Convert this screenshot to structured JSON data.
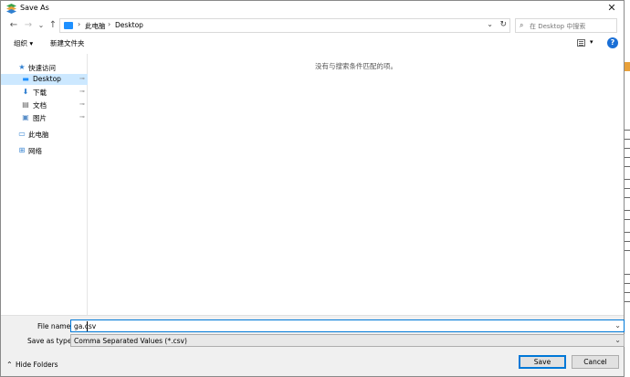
{
  "window": {
    "title": "Save As",
    "close_glyph": "✕"
  },
  "nav": {
    "back": "←",
    "forward": "→",
    "recent": "⌄",
    "up": "↑",
    "breadcrumb": [
      "此电脑",
      "Desktop"
    ],
    "search_placeholder": "在 Desktop 中搜索"
  },
  "toolbar": {
    "organize": "组织 ▾",
    "new_folder": "新建文件夹",
    "view_dropdown": "▾",
    "help": "?"
  },
  "sidebar": {
    "items": [
      {
        "label": "快速访问",
        "icon": "star-icon",
        "glyph": "★"
      },
      {
        "label": "Desktop",
        "icon": "desktop-folder-icon",
        "glyph": "▬",
        "pinned": true,
        "selected": true
      },
      {
        "label": "下载",
        "icon": "download-icon",
        "glyph": "⬇",
        "pinned": true
      },
      {
        "label": "文档",
        "icon": "document-icon",
        "glyph": "▤",
        "pinned": true
      },
      {
        "label": "图片",
        "icon": "picture-icon",
        "glyph": "▣",
        "pinned": true
      },
      {
        "label": "此电脑",
        "icon": "computer-icon",
        "glyph": "▭"
      },
      {
        "label": "网络",
        "icon": "network-icon",
        "glyph": "⊞"
      }
    ],
    "pin_glyph": "📌"
  },
  "content": {
    "empty_message": "没有与搜索条件匹配的项。"
  },
  "form": {
    "file_name_label": "File name:",
    "file_name_value": "ga.csv",
    "save_type_label": "Save as type:",
    "save_type_value": "Comma Separated Values (*.csv)"
  },
  "footer": {
    "hide_folders": "Hide Folders",
    "save": "Save",
    "cancel": "Cancel"
  },
  "colors": {
    "selected_bg": "#cce8ff",
    "accent": "#0078d7",
    "help": "#1a6fd6"
  }
}
